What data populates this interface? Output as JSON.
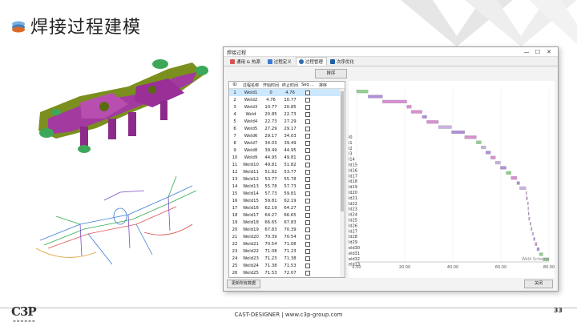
{
  "slide": {
    "title": "焊接过程建模",
    "footer": "CAST-DESIGNER | www.c3p-group.com",
    "page_number": "33",
    "logo": "C3P"
  },
  "window": {
    "title": "焊接过程",
    "controls": {
      "minimize": "—",
      "maximize": "☐",
      "close": "✕"
    },
    "tabs": [
      {
        "label": "通用 & 热源",
        "icon": "heat-source-icon",
        "active": false
      },
      {
        "label": "过程定义",
        "icon": "process-define-icon",
        "active": false
      },
      {
        "label": "过程管理",
        "icon": "process-manage-icon",
        "active": true
      },
      {
        "label": "次序优化",
        "icon": "sequence-optimize-icon",
        "active": false
      }
    ],
    "sort_button": "排序",
    "update_button": "更新所有数据",
    "close_button": "关闭",
    "table": {
      "columns": [
        "ID",
        "过程名称",
        "开始时间",
        "终止时间",
        "Seq ...",
        "排序"
      ],
      "rows": [
        {
          "id": "1",
          "name": "Weld1",
          "start": "0",
          "end": "4.76"
        },
        {
          "id": "2",
          "name": "Weld2",
          "start": "4.76",
          "end": "10.77"
        },
        {
          "id": "3",
          "name": "Weld3",
          "start": "10.77",
          "end": "20.85"
        },
        {
          "id": "4",
          "name": "Weld",
          "start": "20.85",
          "end": "22.73"
        },
        {
          "id": "5",
          "name": "Weld4",
          "start": "22.73",
          "end": "27.29"
        },
        {
          "id": "6",
          "name": "Weld5",
          "start": "27.29",
          "end": "29.17"
        },
        {
          "id": "7",
          "name": "Weld6",
          "start": "29.17",
          "end": "34.03"
        },
        {
          "id": "8",
          "name": "Weld7",
          "start": "34.03",
          "end": "39.49"
        },
        {
          "id": "9",
          "name": "Weld8",
          "start": "39.49",
          "end": "44.95"
        },
        {
          "id": "10",
          "name": "Weld9",
          "start": "44.95",
          "end": "49.81"
        },
        {
          "id": "11",
          "name": "Weld10",
          "start": "49.81",
          "end": "51.82"
        },
        {
          "id": "12",
          "name": "Weld11",
          "start": "51.82",
          "end": "53.77"
        },
        {
          "id": "13",
          "name": "Weld12",
          "start": "53.77",
          "end": "55.78"
        },
        {
          "id": "14",
          "name": "Weld13",
          "start": "55.78",
          "end": "57.73"
        },
        {
          "id": "15",
          "name": "Weld14",
          "start": "57.73",
          "end": "59.81"
        },
        {
          "id": "16",
          "name": "Weld15",
          "start": "59.81",
          "end": "62.19"
        },
        {
          "id": "17",
          "name": "Weld16",
          "start": "62.19",
          "end": "64.27"
        },
        {
          "id": "18",
          "name": "Weld17",
          "start": "64.27",
          "end": "66.65"
        },
        {
          "id": "19",
          "name": "Weld18",
          "start": "66.65",
          "end": "67.83"
        },
        {
          "id": "20",
          "name": "Weld19",
          "start": "67.83",
          "end": "70.39"
        },
        {
          "id": "21",
          "name": "Weld20",
          "start": "70.39",
          "end": "70.54"
        },
        {
          "id": "22",
          "name": "Weld21",
          "start": "70.54",
          "end": "71.08"
        },
        {
          "id": "23",
          "name": "Weld22",
          "start": "71.08",
          "end": "71.23"
        },
        {
          "id": "24",
          "name": "Weld23",
          "start": "71.23",
          "end": "71.38"
        },
        {
          "id": "25",
          "name": "Weld24",
          "start": "71.38",
          "end": "71.53"
        },
        {
          "id": "26",
          "name": "Weld25",
          "start": "71.53",
          "end": "72.07"
        }
      ]
    }
  },
  "chart_data": {
    "type": "bar",
    "subtype": "gantt",
    "x_ticks": [
      "0.00",
      "20.00",
      "40.00",
      "60.00",
      "80.00"
    ],
    "xlim": [
      0,
      80
    ],
    "y_tick_labels": [
      "l0",
      "l1",
      "l2",
      "l3",
      "l14",
      "ld15",
      "ld16",
      "ld17",
      "ld18",
      "ld19",
      "ld20",
      "ld21",
      "ld22",
      "ld23",
      "ld24",
      "ld25",
      "ld26",
      "ld27",
      "ld28",
      "ld29",
      "eld30",
      "eld31",
      "eld32",
      "eld33"
    ],
    "corner_label": "Weld Scheme",
    "bars": [
      {
        "start": 0,
        "end": 4.76,
        "color": "#8fd18f"
      },
      {
        "start": 4.76,
        "end": 10.77,
        "color": "#b08fd8"
      },
      {
        "start": 10.77,
        "end": 20.85,
        "color": "#d88fcf"
      },
      {
        "start": 20.85,
        "end": 22.73,
        "color": "#d88fcf"
      },
      {
        "start": 22.73,
        "end": 27.29,
        "color": "#d88fcf"
      },
      {
        "start": 27.29,
        "end": 29.17,
        "color": "#b08fd8"
      },
      {
        "start": 29.17,
        "end": 34.03,
        "color": "#d88fcf"
      },
      {
        "start": 34.03,
        "end": 39.49,
        "color": "#c8b3e0"
      },
      {
        "start": 39.49,
        "end": 44.95,
        "color": "#b08fd8"
      },
      {
        "start": 44.95,
        "end": 49.81,
        "color": "#d88fcf"
      },
      {
        "start": 49.81,
        "end": 51.82,
        "color": "#8fd18f"
      },
      {
        "start": 51.82,
        "end": 53.77,
        "color": "#c8b3e0"
      },
      {
        "start": 53.77,
        "end": 55.78,
        "color": "#b08fd8"
      },
      {
        "start": 55.78,
        "end": 57.73,
        "color": "#d88fcf"
      },
      {
        "start": 57.73,
        "end": 59.81,
        "color": "#c8b3e0"
      },
      {
        "start": 59.81,
        "end": 62.19,
        "color": "#b08fd8"
      },
      {
        "start": 62.19,
        "end": 64.27,
        "color": "#8fd18f"
      },
      {
        "start": 64.27,
        "end": 66.65,
        "color": "#d88fcf"
      },
      {
        "start": 66.65,
        "end": 67.83,
        "color": "#b08fd8"
      },
      {
        "start": 67.83,
        "end": 70.39,
        "color": "#c8b3e0"
      },
      {
        "start": 70.39,
        "end": 70.54,
        "color": "#d88fcf"
      },
      {
        "start": 70.54,
        "end": 71.08,
        "color": "#b08fd8"
      },
      {
        "start": 71.08,
        "end": 71.23,
        "color": "#d88fcf"
      },
      {
        "start": 71.23,
        "end": 71.38,
        "color": "#c8b3e0"
      },
      {
        "start": 71.38,
        "end": 71.53,
        "color": "#b08fd8"
      },
      {
        "start": 71.53,
        "end": 72.07,
        "color": "#d88fcf"
      },
      {
        "start": 72.07,
        "end": 72.5,
        "color": "#b08fd8"
      },
      {
        "start": 72.5,
        "end": 73.0,
        "color": "#d88fcf"
      },
      {
        "start": 73.0,
        "end": 73.6,
        "color": "#c8b3e0"
      },
      {
        "start": 73.6,
        "end": 74.2,
        "color": "#b08fd8"
      },
      {
        "start": 74.2,
        "end": 75.0,
        "color": "#d88fcf"
      },
      {
        "start": 75.0,
        "end": 76.0,
        "color": "#b08fd8"
      },
      {
        "start": 76.0,
        "end": 77.5,
        "color": "#8fd18f"
      },
      {
        "start": 77.5,
        "end": 80.0,
        "color": "#8fd18f"
      }
    ]
  }
}
